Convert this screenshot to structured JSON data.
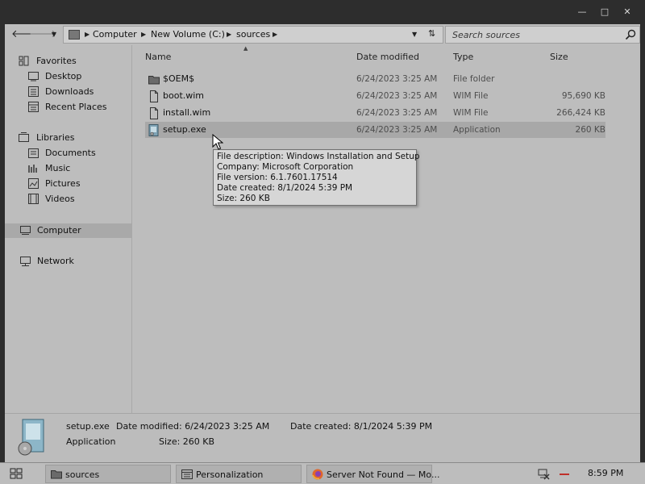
{
  "window": {
    "controls": {
      "minimize": "—",
      "maximize": "□",
      "close": "✕"
    }
  },
  "nav": {
    "back": "🡐",
    "forward": "🡒",
    "recent": "▼",
    "breadcrumbs": [
      "Computer",
      "New Volume (C:)",
      "sources"
    ],
    "search_placeholder": "Search sources"
  },
  "sidebar": {
    "groups": [
      {
        "label": "Favorites",
        "icon": "star-icon",
        "items": [
          {
            "label": "Desktop",
            "icon": "desktop-icon"
          },
          {
            "label": "Downloads",
            "icon": "downloads-icon"
          },
          {
            "label": "Recent Places",
            "icon": "recent-places-icon"
          }
        ]
      },
      {
        "label": "Libraries",
        "icon": "libraries-icon",
        "items": [
          {
            "label": "Documents",
            "icon": "documents-icon"
          },
          {
            "label": "Music",
            "icon": "music-icon"
          },
          {
            "label": "Pictures",
            "icon": "pictures-icon"
          },
          {
            "label": "Videos",
            "icon": "videos-icon"
          }
        ]
      },
      {
        "label": "Computer",
        "icon": "computer-icon",
        "selected": true,
        "items": []
      },
      {
        "label": "Network",
        "icon": "network-icon",
        "items": []
      }
    ]
  },
  "columns": {
    "name": "Name",
    "date": "Date modified",
    "type": "Type",
    "size": "Size"
  },
  "files": [
    {
      "name": "$OEM$",
      "date": "6/24/2023 3:25 AM",
      "type": "File folder",
      "size": "",
      "icon": "folder-icon"
    },
    {
      "name": "boot.wim",
      "date": "6/24/2023 3:25 AM",
      "type": "WIM File",
      "size": "95,690 KB",
      "icon": "file-icon"
    },
    {
      "name": "install.wim",
      "date": "6/24/2023 3:25 AM",
      "type": "WIM File",
      "size": "266,424 KB",
      "icon": "file-icon"
    },
    {
      "name": "setup.exe",
      "date": "6/24/2023 3:25 AM",
      "type": "Application",
      "size": "260 KB",
      "icon": "setup-exe-icon",
      "selected": true
    }
  ],
  "tooltip": {
    "lines": [
      "File description: Windows Installation and Setup",
      "Company: Microsoft Corporation",
      "File version: 6.1.7601.17514",
      "Date created: 8/1/2024 5:39 PM",
      "Size: 260 KB"
    ]
  },
  "details": {
    "name": "setup.exe",
    "kind": "Application",
    "date_modified": "Date modified: 6/24/2023 3:25 AM",
    "date_created": "Date created: 8/1/2024 5:39 PM",
    "size": "Size: 260 KB"
  },
  "taskbar": {
    "items": [
      {
        "label": "sources",
        "icon": "folder-icon"
      },
      {
        "label": "Personalization",
        "icon": "control-panel-icon"
      },
      {
        "label": "Server Not Found — Mo...",
        "icon": "firefox-icon"
      }
    ],
    "clock": "8:59 PM"
  }
}
